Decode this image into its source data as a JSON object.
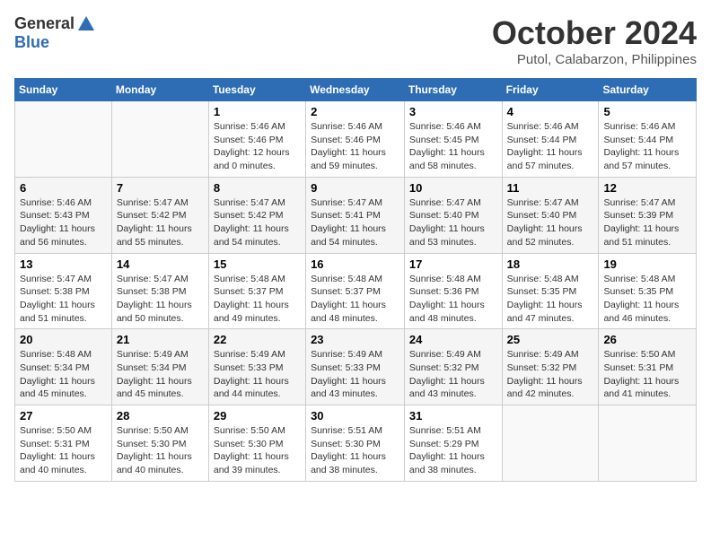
{
  "logo": {
    "general": "General",
    "blue": "Blue"
  },
  "title": "October 2024",
  "location": "Putol, Calabarzon, Philippines",
  "headers": [
    "Sunday",
    "Monday",
    "Tuesday",
    "Wednesday",
    "Thursday",
    "Friday",
    "Saturday"
  ],
  "rows": [
    [
      {
        "day": "",
        "info": ""
      },
      {
        "day": "",
        "info": ""
      },
      {
        "day": "1",
        "info": "Sunrise: 5:46 AM\nSunset: 5:46 PM\nDaylight: 12 hours\nand 0 minutes."
      },
      {
        "day": "2",
        "info": "Sunrise: 5:46 AM\nSunset: 5:46 PM\nDaylight: 11 hours\nand 59 minutes."
      },
      {
        "day": "3",
        "info": "Sunrise: 5:46 AM\nSunset: 5:45 PM\nDaylight: 11 hours\nand 58 minutes."
      },
      {
        "day": "4",
        "info": "Sunrise: 5:46 AM\nSunset: 5:44 PM\nDaylight: 11 hours\nand 57 minutes."
      },
      {
        "day": "5",
        "info": "Sunrise: 5:46 AM\nSunset: 5:44 PM\nDaylight: 11 hours\nand 57 minutes."
      }
    ],
    [
      {
        "day": "6",
        "info": "Sunrise: 5:46 AM\nSunset: 5:43 PM\nDaylight: 11 hours\nand 56 minutes."
      },
      {
        "day": "7",
        "info": "Sunrise: 5:47 AM\nSunset: 5:42 PM\nDaylight: 11 hours\nand 55 minutes."
      },
      {
        "day": "8",
        "info": "Sunrise: 5:47 AM\nSunset: 5:42 PM\nDaylight: 11 hours\nand 54 minutes."
      },
      {
        "day": "9",
        "info": "Sunrise: 5:47 AM\nSunset: 5:41 PM\nDaylight: 11 hours\nand 54 minutes."
      },
      {
        "day": "10",
        "info": "Sunrise: 5:47 AM\nSunset: 5:40 PM\nDaylight: 11 hours\nand 53 minutes."
      },
      {
        "day": "11",
        "info": "Sunrise: 5:47 AM\nSunset: 5:40 PM\nDaylight: 11 hours\nand 52 minutes."
      },
      {
        "day": "12",
        "info": "Sunrise: 5:47 AM\nSunset: 5:39 PM\nDaylight: 11 hours\nand 51 minutes."
      }
    ],
    [
      {
        "day": "13",
        "info": "Sunrise: 5:47 AM\nSunset: 5:38 PM\nDaylight: 11 hours\nand 51 minutes."
      },
      {
        "day": "14",
        "info": "Sunrise: 5:47 AM\nSunset: 5:38 PM\nDaylight: 11 hours\nand 50 minutes."
      },
      {
        "day": "15",
        "info": "Sunrise: 5:48 AM\nSunset: 5:37 PM\nDaylight: 11 hours\nand 49 minutes."
      },
      {
        "day": "16",
        "info": "Sunrise: 5:48 AM\nSunset: 5:37 PM\nDaylight: 11 hours\nand 48 minutes."
      },
      {
        "day": "17",
        "info": "Sunrise: 5:48 AM\nSunset: 5:36 PM\nDaylight: 11 hours\nand 48 minutes."
      },
      {
        "day": "18",
        "info": "Sunrise: 5:48 AM\nSunset: 5:35 PM\nDaylight: 11 hours\nand 47 minutes."
      },
      {
        "day": "19",
        "info": "Sunrise: 5:48 AM\nSunset: 5:35 PM\nDaylight: 11 hours\nand 46 minutes."
      }
    ],
    [
      {
        "day": "20",
        "info": "Sunrise: 5:48 AM\nSunset: 5:34 PM\nDaylight: 11 hours\nand 45 minutes."
      },
      {
        "day": "21",
        "info": "Sunrise: 5:49 AM\nSunset: 5:34 PM\nDaylight: 11 hours\nand 45 minutes."
      },
      {
        "day": "22",
        "info": "Sunrise: 5:49 AM\nSunset: 5:33 PM\nDaylight: 11 hours\nand 44 minutes."
      },
      {
        "day": "23",
        "info": "Sunrise: 5:49 AM\nSunset: 5:33 PM\nDaylight: 11 hours\nand 43 minutes."
      },
      {
        "day": "24",
        "info": "Sunrise: 5:49 AM\nSunset: 5:32 PM\nDaylight: 11 hours\nand 43 minutes."
      },
      {
        "day": "25",
        "info": "Sunrise: 5:49 AM\nSunset: 5:32 PM\nDaylight: 11 hours\nand 42 minutes."
      },
      {
        "day": "26",
        "info": "Sunrise: 5:50 AM\nSunset: 5:31 PM\nDaylight: 11 hours\nand 41 minutes."
      }
    ],
    [
      {
        "day": "27",
        "info": "Sunrise: 5:50 AM\nSunset: 5:31 PM\nDaylight: 11 hours\nand 40 minutes."
      },
      {
        "day": "28",
        "info": "Sunrise: 5:50 AM\nSunset: 5:30 PM\nDaylight: 11 hours\nand 40 minutes."
      },
      {
        "day": "29",
        "info": "Sunrise: 5:50 AM\nSunset: 5:30 PM\nDaylight: 11 hours\nand 39 minutes."
      },
      {
        "day": "30",
        "info": "Sunrise: 5:51 AM\nSunset: 5:30 PM\nDaylight: 11 hours\nand 38 minutes."
      },
      {
        "day": "31",
        "info": "Sunrise: 5:51 AM\nSunset: 5:29 PM\nDaylight: 11 hours\nand 38 minutes."
      },
      {
        "day": "",
        "info": ""
      },
      {
        "day": "",
        "info": ""
      }
    ]
  ]
}
